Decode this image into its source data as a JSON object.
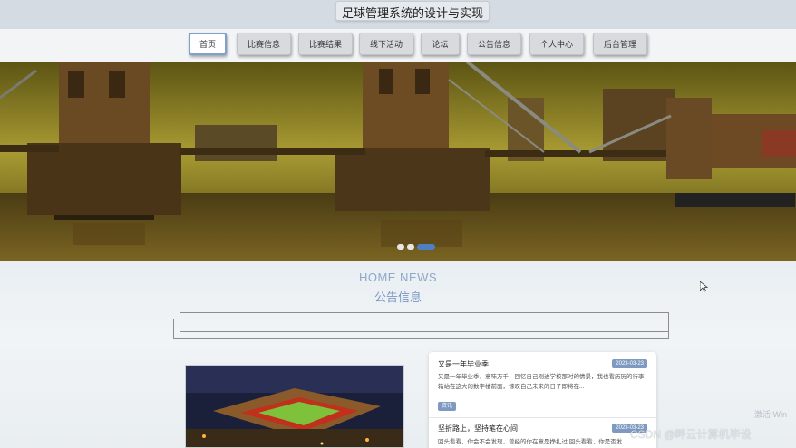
{
  "header": {
    "title": "足球管理系统的设计与实现"
  },
  "nav": {
    "items": [
      {
        "label": "首页",
        "active": true
      },
      {
        "label": "比赛信息",
        "active": false
      },
      {
        "label": "比赛结果",
        "active": false
      },
      {
        "label": "线下活动",
        "active": false
      },
      {
        "label": "论坛",
        "active": false
      },
      {
        "label": "公告信息",
        "active": false
      },
      {
        "label": "个人中心",
        "active": false
      },
      {
        "label": "后台管理",
        "active": false
      }
    ]
  },
  "banner": {
    "slide_count": 3,
    "active_slide": 2
  },
  "news_section": {
    "title_en": "HOME NEWS",
    "title_cn": "公告信息",
    "items": [
      {
        "title": "又是一年毕业季",
        "date": "2023-03-23",
        "summary": "又是一年毕业季，意味万千，回忆自己刚进学校那时的情景，我也看历历的行李箱站在这大的数字楼前面，惊叹自己未来的日子即将在...",
        "tag": "资讯"
      },
      {
        "title": "坚折路上，坚持笔在心间",
        "date": "2023-03-23",
        "summary": "回头看看，你会不会发现，曾经的你在意是挣扎过 回头看看，你是否发",
        "tag": ""
      }
    ]
  },
  "overlay": {
    "activation_text": "激活 Win",
    "watermark": "CSDN @畔云计算机毕设"
  },
  "colors": {
    "accent": "#7da0cf",
    "nav_bg": "#d8dadd",
    "badge": "#7e9ac0"
  }
}
